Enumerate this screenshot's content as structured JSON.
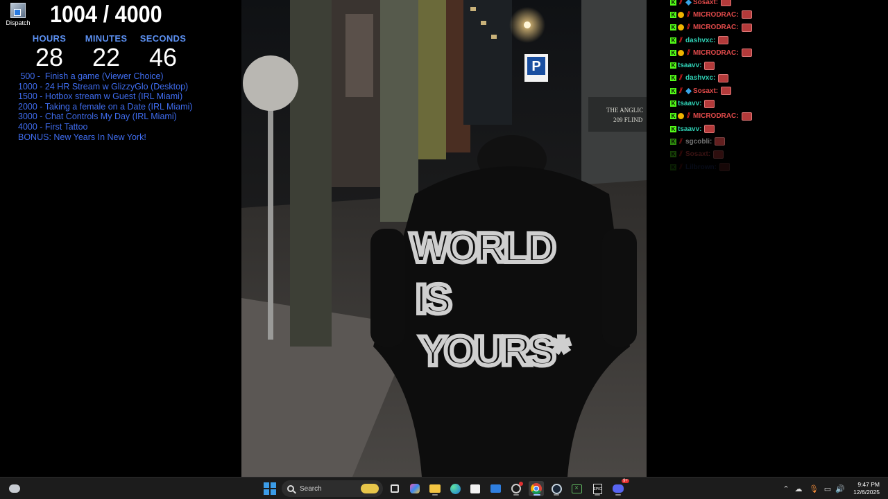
{
  "desktop": {
    "icon_label": "Dispatch"
  },
  "goal": {
    "text": "1004 / 4000"
  },
  "timer": {
    "hours_label": "HOURS",
    "minutes_label": "MINUTES",
    "seconds_label": "SECONDS",
    "hours": "28",
    "minutes": "22",
    "seconds": "46"
  },
  "milestones": [
    " 500 -  Finish a game (Viewer Choice)",
    "1000 - 24 HR Stream w GlizzyGlo (Desktop)",
    "1500 - Hotbox stream w Guest (IRL Miami)",
    "2000 - Taking a female on a Date (IRL Miami)",
    "3000 - Chat Controls My Day (IRL Miami)",
    "4000 - First Tattoo",
    "BONUS: New Years In New York!"
  ],
  "video": {
    "hoodie_line1": "WORLD",
    "hoodie_line2": "IS",
    "hoodie_line3": "YOURS*",
    "sign_line1": "THE ANGLIC",
    "sign_line2": "209 FLIND",
    "parking_letter": "P"
  },
  "chat": {
    "messages": [
      {
        "name": "Sosaxt:",
        "color": "#e04a4a"
      },
      {
        "name": "MICRODRAC:",
        "color": "#e04a4a"
      },
      {
        "name": "MICRODRAC:",
        "color": "#e04a4a"
      },
      {
        "name": "dashvxc:",
        "color": "#2fd0b4"
      },
      {
        "name": "MICRODRAC:",
        "color": "#e04a4a"
      },
      {
        "name": "tsaavv:",
        "color": "#2fd0b4"
      },
      {
        "name": "dashvxc:",
        "color": "#2fd0b4"
      },
      {
        "name": "Sosaxt:",
        "color": "#e04a4a"
      },
      {
        "name": "tsaavv:",
        "color": "#2fd0b4"
      },
      {
        "name": "MICRODRAC:",
        "color": "#e04a4a"
      },
      {
        "name": "tsaavv:",
        "color": "#2fd0b4"
      },
      {
        "name": "sgcobli:",
        "color": "#cfcfcf"
      },
      {
        "name": "Sosaxt:",
        "color": "#e04a4a"
      },
      {
        "name": "Lilbrown:",
        "color": "#3a5fc4"
      }
    ]
  },
  "taskbar": {
    "search_placeholder": "Search",
    "discord_badge": "9+",
    "time": "9:47 PM",
    "date": "12/6/2025"
  }
}
